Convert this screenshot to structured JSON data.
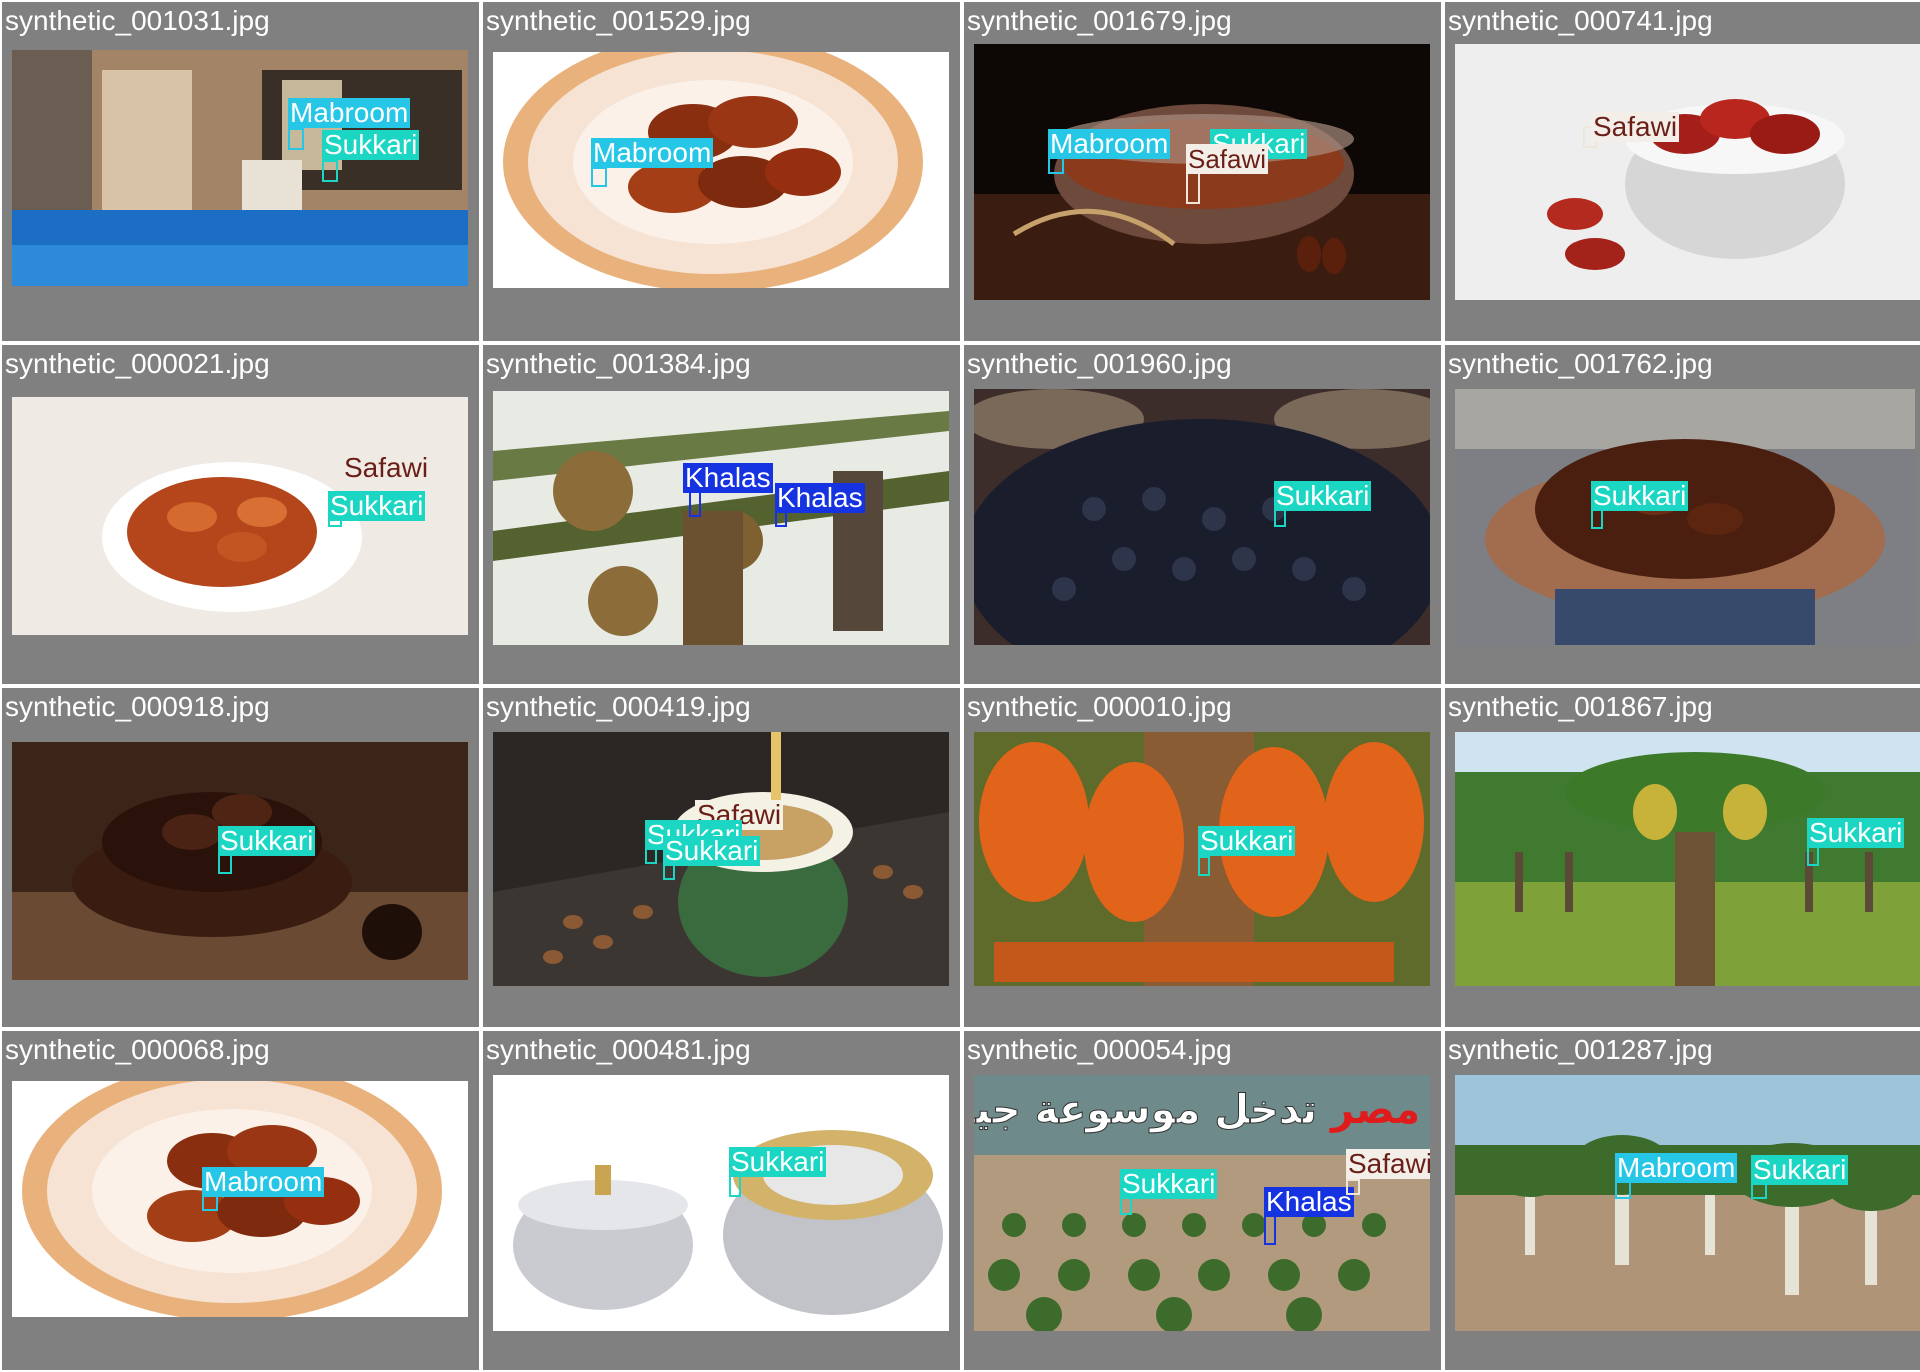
{
  "tiles": [
    {
      "filename": "synthetic_001031.jpg",
      "scene": "resort",
      "detections": [
        {
          "label": "Mabroom",
          "cls": "mabroom"
        },
        {
          "label": "Sukkari",
          "cls": "sukkari"
        }
      ]
    },
    {
      "filename": "synthetic_001529.jpg",
      "scene": "plate",
      "detections": [
        {
          "label": "Mabroom",
          "cls": "mabroom"
        }
      ]
    },
    {
      "filename": "synthetic_001679.jpg",
      "scene": "glassbowl",
      "detections": [
        {
          "label": "Mabroom",
          "cls": "mabroom"
        },
        {
          "label": "Sukkari",
          "cls": "sukkari"
        },
        {
          "label": "Safawi",
          "cls": "safawi"
        }
      ]
    },
    {
      "filename": "synthetic_000741.jpg",
      "scene": "whitebowl",
      "detections": [
        {
          "label": "Safawi",
          "cls": "safawi"
        }
      ]
    },
    {
      "filename": "synthetic_000021.jpg",
      "scene": "creambowl",
      "detections": [
        {
          "label": "Safawi",
          "cls": "safawi"
        },
        {
          "label": "Sukkari",
          "cls": "sukkari"
        }
      ]
    },
    {
      "filename": "synthetic_001384.jpg",
      "scene": "palmclimb",
      "detections": [
        {
          "label": "Khalas",
          "cls": "khalas"
        },
        {
          "label": "Khalas",
          "cls": "khalas"
        }
      ]
    },
    {
      "filename": "synthetic_001960.jpg",
      "scene": "blackdates",
      "detections": [
        {
          "label": "Sukkari",
          "cls": "sukkari"
        }
      ]
    },
    {
      "filename": "synthetic_001762.jpg",
      "scene": "hands",
      "detections": [
        {
          "label": "Sukkari",
          "cls": "sukkari"
        }
      ]
    },
    {
      "filename": "synthetic_000918.jpg",
      "scene": "darkbowl",
      "detections": [
        {
          "label": "Sukkari",
          "cls": "sukkari"
        }
      ]
    },
    {
      "filename": "synthetic_000419.jpg",
      "scene": "coffee",
      "detections": [
        {
          "label": "Safawi",
          "cls": "safawi"
        },
        {
          "label": "Sukkari",
          "cls": "sukkari"
        },
        {
          "label": "Sukkari",
          "cls": "sukkari"
        }
      ]
    },
    {
      "filename": "synthetic_000010.jpg",
      "scene": "orangedates",
      "detections": [
        {
          "label": "Sukkari",
          "cls": "sukkari"
        }
      ]
    },
    {
      "filename": "synthetic_001867.jpg",
      "scene": "plantation",
      "detections": [
        {
          "label": "Sukkari",
          "cls": "sukkari"
        }
      ]
    },
    {
      "filename": "synthetic_000068.jpg",
      "scene": "plate",
      "detections": [
        {
          "label": "Mabroom",
          "cls": "mabroom"
        }
      ]
    },
    {
      "filename": "synthetic_000481.jpg",
      "scene": "silverbowls",
      "detections": [
        {
          "label": "Sukkari",
          "cls": "sukkari"
        }
      ]
    },
    {
      "filename": "synthetic_000054.jpg",
      "scene": "farm",
      "detections": [
        {
          "label": "Sukkari",
          "cls": "sukkari"
        },
        {
          "label": "Khalas",
          "cls": "khalas"
        },
        {
          "label": "Safawi",
          "cls": "safawi"
        }
      ]
    },
    {
      "filename": "synthetic_001287.jpg",
      "scene": "youngpalms",
      "detections": [
        {
          "label": "Mabroom",
          "cls": "mabroom"
        },
        {
          "label": "Sukkari",
          "cls": "sukkari"
        }
      ]
    }
  ],
  "overlay_texts": {
    "farm_headline_red": "مصر",
    "farm_headline_white": "تدخل موسوعة جينيس"
  },
  "colors": {
    "tile_background": "#808080",
    "caption_text": "#ffffff",
    "sukkari": "#1bd6c3",
    "mabroom": "#25c6e6",
    "khalas": "#1533e0",
    "safawi": "#f3efe8"
  }
}
